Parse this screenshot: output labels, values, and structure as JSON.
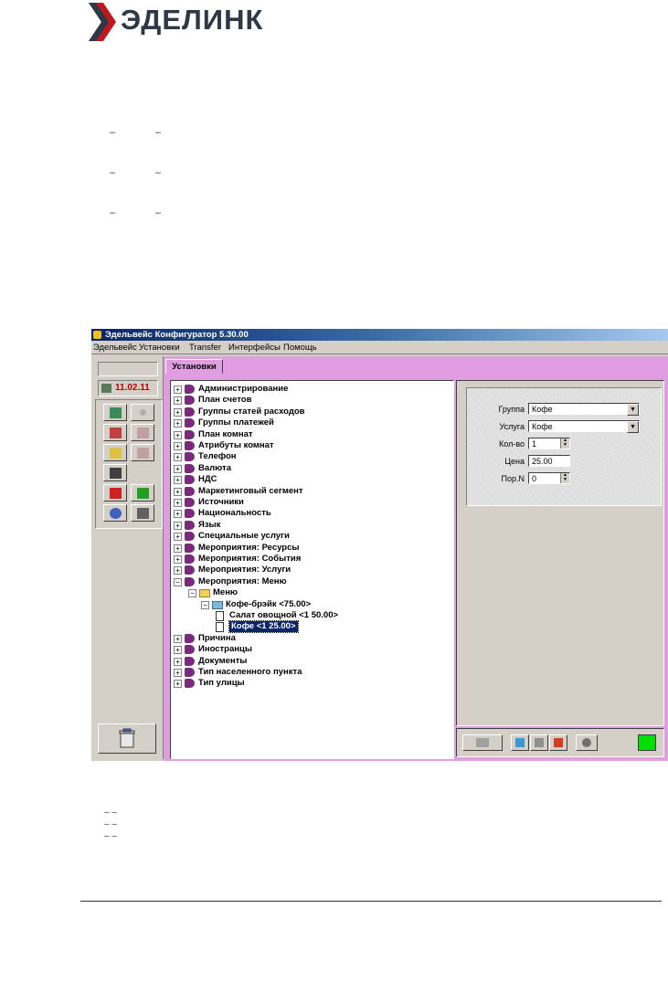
{
  "logo": {
    "text": "ЭДЕЛИНК"
  },
  "doc_dashes": [
    "–",
    "–",
    "–",
    "–",
    "–",
    "–"
  ],
  "doc_small_dashes": [
    "– –",
    "– –",
    "– –"
  ],
  "window": {
    "title": "Эдельвейс Конфигуратор 5.30.00",
    "menu": [
      "Эдельвейс",
      "Установки",
      "Transfer",
      "Интерфейсы",
      "Помощь"
    ],
    "date": "11.02.11",
    "tab": "Установки",
    "tree": [
      {
        "label": "Администрирование",
        "level": 0,
        "type": "book",
        "expander": "+"
      },
      {
        "label": "План счетов",
        "level": 0,
        "type": "book",
        "expander": "+"
      },
      {
        "label": "Группы статей расходов",
        "level": 0,
        "type": "book",
        "expander": "+"
      },
      {
        "label": "Группы платежей",
        "level": 0,
        "type": "book",
        "expander": "+"
      },
      {
        "label": "План комнат",
        "level": 0,
        "type": "book",
        "expander": "+"
      },
      {
        "label": "Атрибуты комнат",
        "level": 0,
        "type": "book",
        "expander": "+"
      },
      {
        "label": "Телефон",
        "level": 0,
        "type": "book",
        "expander": "+"
      },
      {
        "label": "Валюта",
        "level": 0,
        "type": "book",
        "expander": "+"
      },
      {
        "label": "НДС",
        "level": 0,
        "type": "book",
        "expander": "+"
      },
      {
        "label": "Маркетинговый сегмент",
        "level": 0,
        "type": "book",
        "expander": "+"
      },
      {
        "label": "Источники",
        "level": 0,
        "type": "book",
        "expander": "+"
      },
      {
        "label": "Национальность",
        "level": 0,
        "type": "book",
        "expander": "+"
      },
      {
        "label": "Язык",
        "level": 0,
        "type": "book",
        "expander": "+"
      },
      {
        "label": "Специальные услуги",
        "level": 0,
        "type": "book",
        "expander": "+"
      },
      {
        "label": "Мероприятия: Ресурсы",
        "level": 0,
        "type": "book",
        "expander": "+"
      },
      {
        "label": "Мероприятия: События",
        "level": 0,
        "type": "book",
        "expander": "+"
      },
      {
        "label": "Мероприятия: Услуги",
        "level": 0,
        "type": "book",
        "expander": "+"
      },
      {
        "label": "Мероприятия: Меню",
        "level": 0,
        "type": "book",
        "expander": "−"
      },
      {
        "label": "Меню",
        "level": 1,
        "type": "folder",
        "expander": "−"
      },
      {
        "label": "Кофе-брэйк <75.00>",
        "level": 2,
        "type": "folder-blue",
        "expander": "−"
      },
      {
        "label": "Салат овощной <1 50.00>",
        "level": 3,
        "type": "doc",
        "expander": ""
      },
      {
        "label": "Кофе <1 25.00>",
        "level": 3,
        "type": "doc",
        "expander": "",
        "selected": true
      },
      {
        "label": "Причина",
        "level": 0,
        "type": "book",
        "expander": "+"
      },
      {
        "label": "Иностранцы",
        "level": 0,
        "type": "book",
        "expander": "+"
      },
      {
        "label": "Документы",
        "level": 0,
        "type": "book",
        "expander": "+"
      },
      {
        "label": "Тип населенного пункта",
        "level": 0,
        "type": "book",
        "expander": "+"
      },
      {
        "label": "Тип улицы",
        "level": 0,
        "type": "book",
        "expander": "+"
      }
    ],
    "form": {
      "group_label": "Группа",
      "group_value": "Кофе",
      "service_label": "Услуга",
      "service_value": "Кофе",
      "qty_label": "Кол-во",
      "qty_value": "1",
      "price_label": "Цена",
      "price_value": "25.00",
      "order_label": "Пор.N",
      "order_value": "0"
    },
    "status_color": "#00e000"
  }
}
